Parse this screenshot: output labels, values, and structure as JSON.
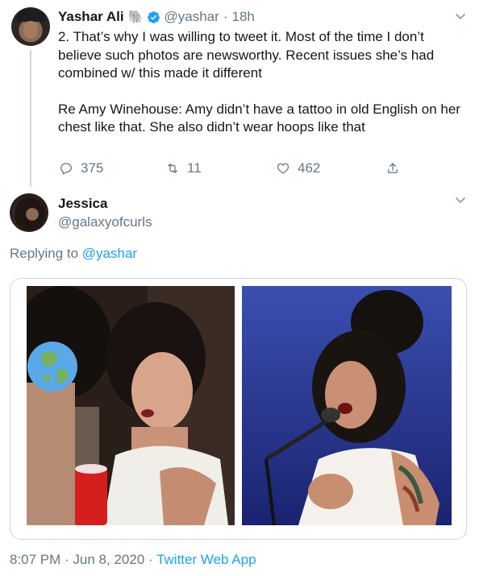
{
  "tweet1": {
    "author_name": "Yashar Ali",
    "author_emoji": "🐘",
    "handle": "@yashar",
    "separator": "·",
    "time": "18h",
    "text_p1": "2. That’s why I was willing to tweet it. Most of the time I don’t believe such photos are newsworthy. Recent issues she’s had combined w/ this made it different",
    "text_p2": "Re Amy Winehouse: Amy didn’t have a tattoo in old English on her chest like that. She also didn’t wear hoops like that",
    "reply_count": "375",
    "retweet_count": "11",
    "like_count": "462"
  },
  "tweet2": {
    "author_name": "Jessica",
    "handle": "@galaxyofcurls",
    "replying_prefix": "Replying to",
    "replying_handle": "@yashar",
    "timestamp": "8:07 PM · Jun 8, 2020 · ",
    "source": "Twitter Web App"
  },
  "colors": {
    "link": "#1da1f2",
    "secondary_text": "#657786",
    "primary_text": "#14171a",
    "border": "#ccd6dd"
  }
}
